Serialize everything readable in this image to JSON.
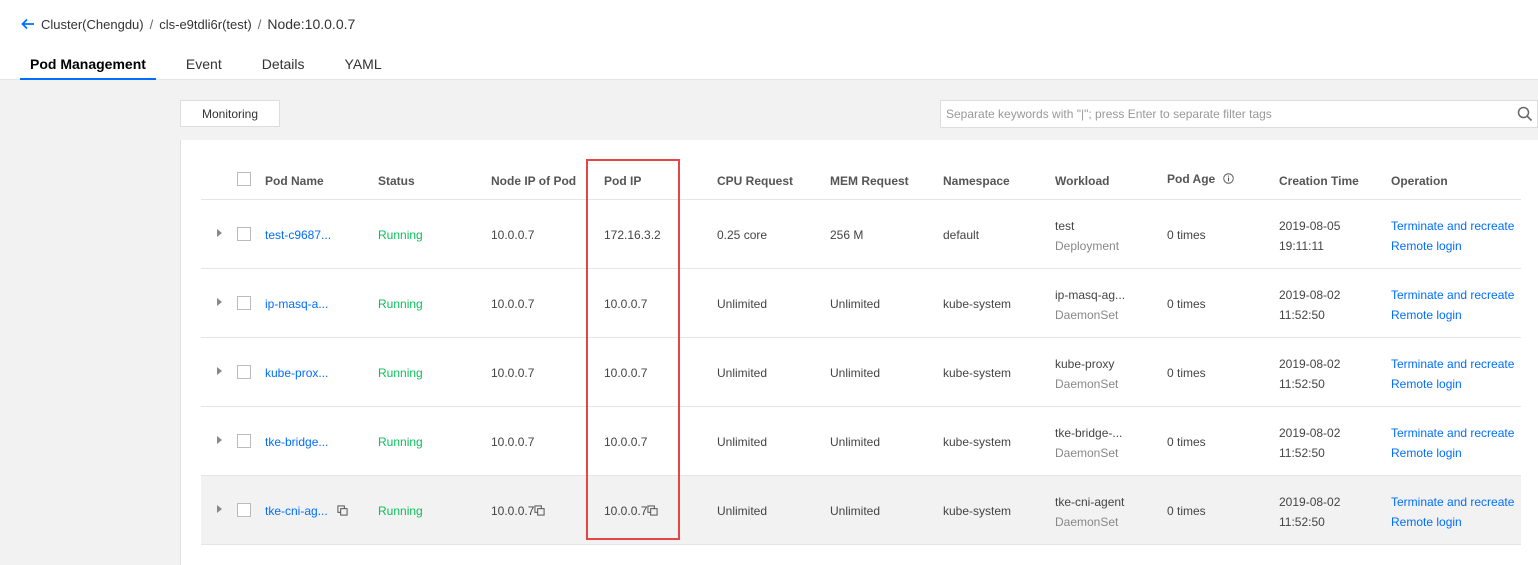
{
  "breadcrumb": {
    "cluster": "Cluster(Chengdu)",
    "cluster_id": "cls-e9tdli6r(test)",
    "node": "Node:10.0.0.7",
    "separator": "/"
  },
  "tabs": [
    "Pod Management",
    "Event",
    "Details",
    "YAML"
  ],
  "toolbar": {
    "monitoring_label": "Monitoring",
    "search_placeholder": "Separate keywords with \"|\"; press Enter to separate filter tags"
  },
  "table": {
    "columns": {
      "pod_name": "Pod Name",
      "status": "Status",
      "node_ip": "Node IP of Pod",
      "pod_ip": "Pod IP",
      "cpu": "CPU Request",
      "mem": "MEM Request",
      "namespace": "Namespace",
      "workload": "Workload",
      "pod_age": "Pod Age",
      "created": "Creation Time",
      "operation": "Operation"
    },
    "rows": [
      {
        "name": "test-c9687...",
        "status": "Running",
        "node_ip": "10.0.0.7",
        "pod_ip": "172.16.3.2",
        "cpu": "0.25 core",
        "mem": "256 M",
        "namespace": "default",
        "workload_name": "test",
        "workload_type": "Deployment",
        "age": "0 times",
        "created_date": "2019-08-05",
        "created_time": "19:11:11",
        "op1": "Terminate and recreate",
        "op2": "Remote login"
      },
      {
        "name": "ip-masq-a...",
        "status": "Running",
        "node_ip": "10.0.0.7",
        "pod_ip": "10.0.0.7",
        "cpu": "Unlimited",
        "mem": "Unlimited",
        "namespace": "kube-system",
        "workload_name": "ip-masq-ag...",
        "workload_type": "DaemonSet",
        "age": "0 times",
        "created_date": "2019-08-02",
        "created_time": "11:52:50",
        "op1": "Terminate and recreate",
        "op2": "Remote login"
      },
      {
        "name": "kube-prox...",
        "status": "Running",
        "node_ip": "10.0.0.7",
        "pod_ip": "10.0.0.7",
        "cpu": "Unlimited",
        "mem": "Unlimited",
        "namespace": "kube-system",
        "workload_name": "kube-proxy",
        "workload_type": "DaemonSet",
        "age": "0 times",
        "created_date": "2019-08-02",
        "created_time": "11:52:50",
        "op1": "Terminate and recreate",
        "op2": "Remote login"
      },
      {
        "name": "tke-bridge...",
        "status": "Running",
        "node_ip": "10.0.0.7",
        "pod_ip": "10.0.0.7",
        "cpu": "Unlimited",
        "mem": "Unlimited",
        "namespace": "kube-system",
        "workload_name": "tke-bridge-...",
        "workload_type": "DaemonSet",
        "age": "0 times",
        "created_date": "2019-08-02",
        "created_time": "11:52:50",
        "op1": "Terminate and recreate",
        "op2": "Remote login"
      },
      {
        "name": "tke-cni-ag...",
        "status": "Running",
        "node_ip": "10.0.0.7",
        "pod_ip": "10.0.0.7",
        "cpu": "Unlimited",
        "mem": "Unlimited",
        "namespace": "kube-system",
        "workload_name": "tke-cni-agent",
        "workload_type": "DaemonSet",
        "age": "0 times",
        "created_date": "2019-08-02",
        "created_time": "11:52:50",
        "op1": "Terminate and recreate",
        "op2": "Remote login"
      }
    ]
  },
  "colors": {
    "accent": "#006eff",
    "running": "#0abf5b",
    "highlight_box": "#e54545"
  }
}
